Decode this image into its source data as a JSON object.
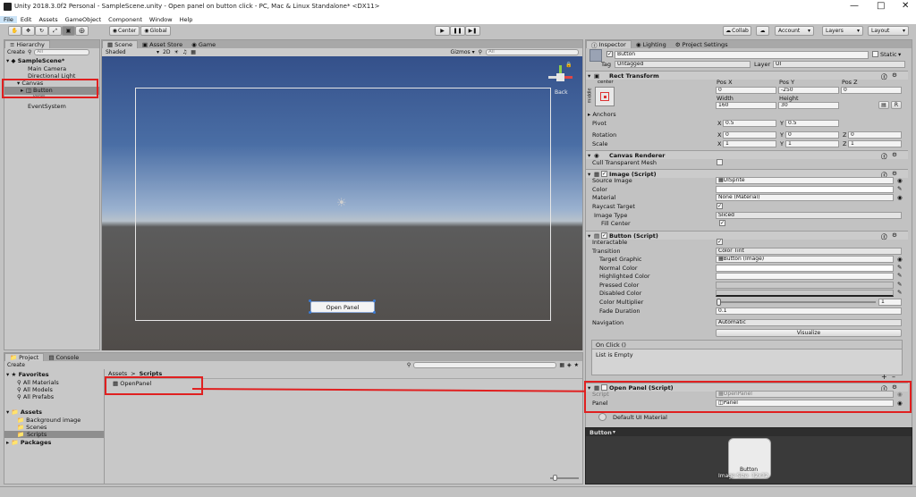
{
  "window": {
    "title": "Unity 2018.3.0f2 Personal - SampleScene.unity - Open panel on button click - PC, Mac & Linux Standalone* <DX11>"
  },
  "menu": [
    "File",
    "Edit",
    "Assets",
    "GameObject",
    "Component",
    "Window",
    "Help"
  ],
  "toolbar": {
    "pivot": "Center",
    "space": "Global",
    "collab": "Collab",
    "account": "Account",
    "layers": "Layers",
    "layout": "Layout"
  },
  "hierarchy": {
    "tab": "Hierarchy",
    "create": "Create",
    "search_placeholder": "All",
    "scene": "SampleScene*",
    "items": [
      "Main Camera",
      "Directional Light",
      "Canvas",
      "Button",
      "Panel",
      "EventSystem"
    ]
  },
  "scene_view": {
    "tabs": [
      "Scene",
      "Asset Store",
      "Game"
    ],
    "shading": "Shaded",
    "mode_2d": "2D",
    "gizmos": "Gizmos",
    "search": "All",
    "back": "Back",
    "button_text": "Open Panel"
  },
  "project": {
    "tabs": [
      "Project",
      "Console"
    ],
    "create": "Create",
    "favorites": "Favorites",
    "fav_items": [
      "All Materials",
      "All Models",
      "All Prefabs"
    ],
    "assets": "Assets",
    "asset_items": [
      "Background image",
      "Scenes",
      "Scripts"
    ],
    "packages": "Packages",
    "breadcrumb": [
      "Assets",
      "Scripts"
    ],
    "file": "OpenPanel"
  },
  "inspector": {
    "tabs": [
      "Inspector",
      "Lighting",
      "Project Settings"
    ],
    "name": "Button",
    "static": "Static",
    "tag_label": "Tag",
    "tag": "Untagged",
    "layer_label": "Layer",
    "layer": "UI",
    "rect": {
      "title": "Rect Transform",
      "anchor": "center",
      "side": "middle",
      "posx_label": "Pos X",
      "posy_label": "Pos Y",
      "posz_label": "Pos Z",
      "posx": "0",
      "posy": "-250",
      "posz": "0",
      "width_label": "Width",
      "height_label": "Height",
      "width": "160",
      "height": "30",
      "anchors": "Anchors",
      "pivot": "Pivot",
      "pivot_x": "0.5",
      "pivot_y": "0.5",
      "rotation": "Rotation",
      "rot_x": "0",
      "rot_y": "0",
      "rot_z": "0",
      "scale": "Scale",
      "scale_x": "1",
      "scale_y": "1",
      "scale_z": "1",
      "x": "X",
      "y": "Y",
      "z": "Z",
      "r": "R"
    },
    "canvas_renderer": {
      "title": "Canvas Renderer",
      "cull": "Cull Transparent Mesh"
    },
    "image": {
      "title": "Image (Script)",
      "source_label": "Source Image",
      "source": "UISprite",
      "color_label": "Color",
      "material_label": "Material",
      "material": "None (Material)",
      "raycast_label": "Raycast Target",
      "type_label": "Image Type",
      "type": "Sliced",
      "fill_label": "Fill Center"
    },
    "button": {
      "title": "Button (Script)",
      "interactable": "Interactable",
      "transition_label": "Transition",
      "transition": "Color Tint",
      "target_label": "Target Graphic",
      "target": "Button (Image)",
      "normal": "Normal Color",
      "highlighted": "Highlighted Color",
      "pressed": "Pressed Color",
      "disabled": "Disabled Color",
      "multiplier_label": "Color Multiplier",
      "multiplier": "1",
      "fade_label": "Fade Duration",
      "fade": "0.1",
      "nav_label": "Navigation",
      "nav": "Automatic",
      "visualize": "Visualize",
      "onclick": "On Click ()",
      "empty": "List is Empty"
    },
    "open_panel": {
      "title": "Open Panel (Script)",
      "script_label": "Script",
      "script": "OpenPanel",
      "panel_label": "Panel",
      "panel": "Panel"
    },
    "material_row": "Default UI Material",
    "preview_title": "Button",
    "preview_label": "Button",
    "preview_size": "Image Size: 32x32"
  },
  "colors": {
    "accent": "#3a7bd5",
    "annotation": "#e02020",
    "panel_bg": "#c2c2c2"
  }
}
